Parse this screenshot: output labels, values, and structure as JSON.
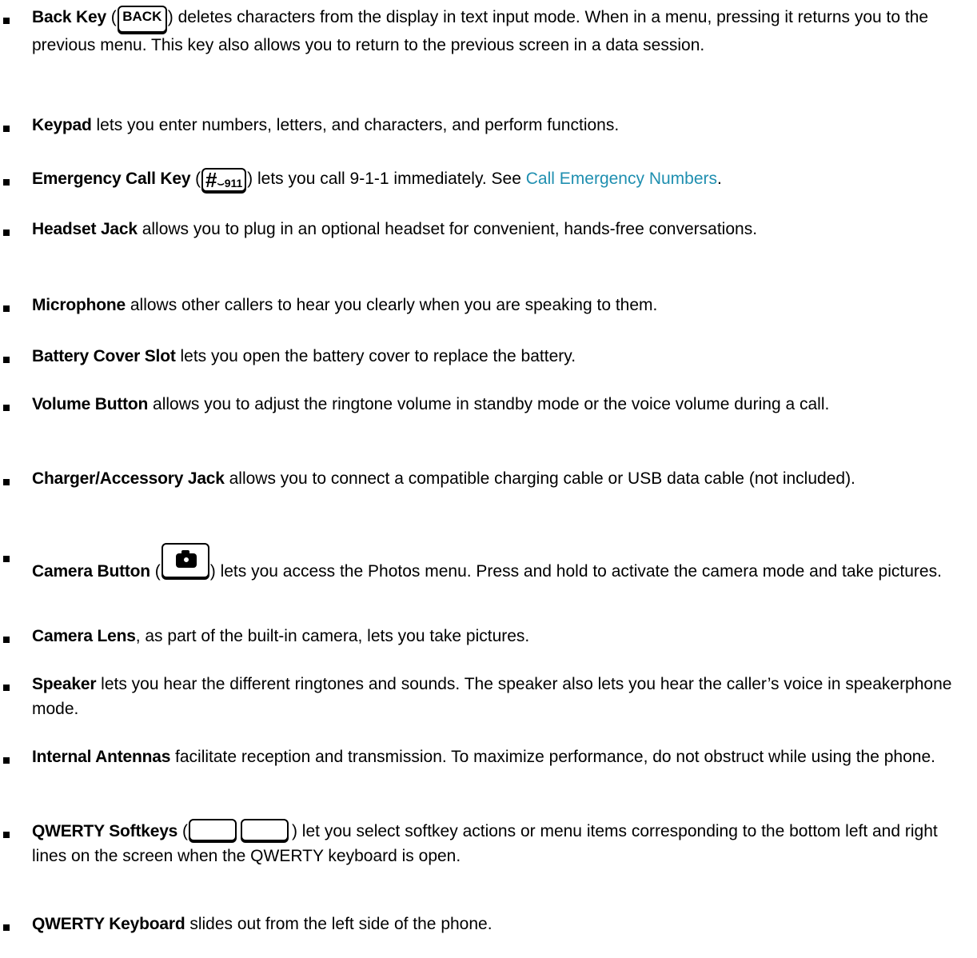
{
  "items": [
    {
      "term": "Back Key",
      "key": "BACK",
      "text": ") deletes characters from the display in text input mode. When in a menu, pressing it returns you to the previous menu. This key also allows you to return to the previous screen in a data session."
    },
    {
      "term": "Keypad",
      "text": "lets you enter numbers, letters, and characters, and perform functions."
    },
    {
      "term": "Emergency Call Key",
      "key": "911",
      "text_before_link": ") lets you call 9-1-1 immediately. See ",
      "link": "Call Emergency Numbers",
      "text_after_link": "."
    },
    {
      "term": "Headset Jack",
      "text": "allows you to plug in an optional headset for convenient, hands-free conversations."
    },
    {
      "term": "Microphone",
      "text": "allows other callers to hear you clearly when you are speaking to them."
    },
    {
      "term": "Battery Cover Slot",
      "text": "lets you open the battery cover to replace the battery."
    },
    {
      "term": "Volume Button",
      "text": "allows you to adjust the ringtone volume in standby mode or the voice volume during a call."
    },
    {
      "term": "Charger/Accessory Jack",
      "text": "allows you to connect a compatible charging cable or USB data cable (not included)."
    },
    {
      "term": "Camera Button",
      "text": ") lets you access the Photos menu. Press and hold to activate the camera mode and take pictures."
    },
    {
      "term": "Camera Lens",
      "text": ", as part of the built-in camera, lets you take pictures."
    },
    {
      "term": "Speaker",
      "text": "lets you hear the different ringtones and sounds. The speaker also lets you hear the caller’s voice in speakerphone mode."
    },
    {
      "term": "Internal Antennas",
      "text": "facilitate reception and transmission. To maximize performance, do not obstruct while using the phone."
    },
    {
      "term": "QWERTY Softkeys",
      "text": ") let you select softkey actions or menu items corresponding to the bottom left and right lines on the screen when the QWERTY keyboard is open."
    },
    {
      "term": "QWERTY Keyboard",
      "text": "slides out from the left side of the phone."
    }
  ],
  "colors": {
    "link": "#1f8fb0"
  }
}
